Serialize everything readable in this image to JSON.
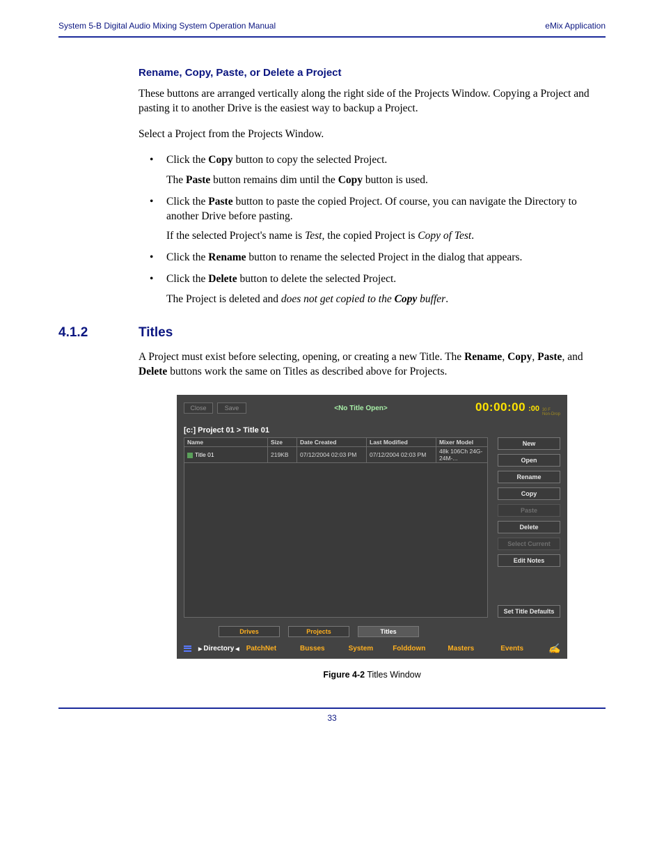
{
  "header": {
    "left": "System 5-B Digital Audio Mixing System Operation Manual",
    "right": "eMix Application"
  },
  "subhead": "Rename, Copy, Paste, or Delete a Project",
  "para1": "These buttons are arranged vertically along the right side of the Projects Window. Copying a Project and pasting it to another Drive is the easiest way to backup a Project.",
  "para2": "Select a Project from the Projects Window.",
  "bullets": {
    "b1a_pre": "Click the ",
    "b1a_bold": "Copy",
    "b1a_post": " button to copy the selected Project.",
    "b1b_pre": "The ",
    "b1b_bold1": "Paste",
    "b1b_mid": " button remains dim until the ",
    "b1b_bold2": "Copy",
    "b1b_post": " button is used.",
    "b2a_pre": "Click the ",
    "b2a_bold": "Paste",
    "b2a_post": " button to paste the copied Project. Of course, you can navigate the Directory to another Drive before pasting.",
    "b2b_pre": "If the selected Project's name is ",
    "b2b_it1": "Test",
    "b2b_mid": ", the copied Project is ",
    "b2b_it2": "Copy of Test",
    "b2b_post": ".",
    "b3_pre": "Click the ",
    "b3_bold": "Rename",
    "b3_post": " button to rename the selected Project in the dialog that appears.",
    "b4a_pre": "Click the ",
    "b4a_bold": "Delete",
    "b4a_post": " button to delete the selected Project.",
    "b4b_pre": "The Project is deleted and ",
    "b4b_it_pre": "does not get copied to the ",
    "b4b_it_bold": "Copy",
    "b4b_it_post": " buffer",
    "b4b_post": "."
  },
  "section": {
    "num": "4.1.2",
    "title": "Titles"
  },
  "titles_para_pre": "A Project must exist before selecting, opening, or creating a new Title. The ",
  "titles_para_b1": "Rename",
  "titles_para_s1": ", ",
  "titles_para_b2": "Copy",
  "titles_para_s2": ", ",
  "titles_para_b3": "Paste",
  "titles_para_s3": ", and ",
  "titles_para_b4": "Delete",
  "titles_para_post": " buttons work the same on Titles as described above for Projects.",
  "screenshot": {
    "top_buttons": {
      "close": "Close",
      "save": "Save"
    },
    "title_center": "<No Title Open>",
    "timecode": "00:00:00",
    "timecode_frames": ":00",
    "time_info1": "30 F",
    "time_info2": "Non-Drop",
    "breadcrumb": "[c:] Project 01 > Title 01",
    "columns": [
      "Name",
      "Size",
      "Date Created",
      "Last Modified",
      "Mixer Model"
    ],
    "row": {
      "name": "Title 01",
      "size": "219KB",
      "created": "07/12/2004 02:03 PM",
      "modified": "07/12/2004 02:03 PM",
      "model": "48k 106Ch 24G-24M-..."
    },
    "actions": [
      "New",
      "Open",
      "Rename",
      "Copy",
      "Paste",
      "Delete",
      "Select Current",
      "Edit Notes"
    ],
    "actions_dim": [
      false,
      false,
      false,
      false,
      true,
      false,
      true,
      false
    ],
    "defaults_btn": "Set Title Defaults",
    "tabs": [
      "Drives",
      "Projects",
      "Titles"
    ],
    "tab_active": 2,
    "bottom_nav": {
      "directory": "Directory",
      "items": [
        "PatchNet",
        "Busses",
        "System",
        "Folddown",
        "Masters",
        "Events"
      ]
    }
  },
  "figure_caption_bold": "Figure 4-2",
  "figure_caption_rest": " Titles Window",
  "page_number": "33"
}
